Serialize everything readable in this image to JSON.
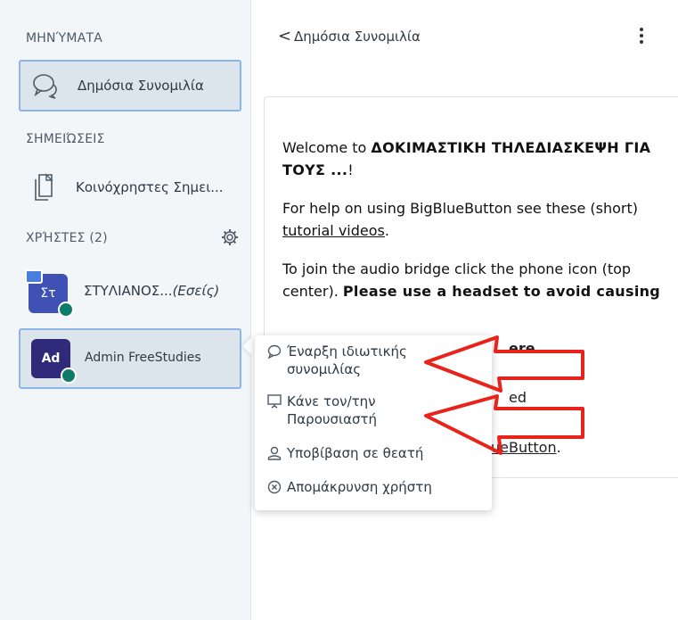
{
  "sidebar": {
    "messages_title": "ΜΗΝΎΜΑΤΑ",
    "public_chat_label": "Δημόσια Συνομιλία",
    "notes_title": "ΣΗΜΕΙΏΣΕΙΣ",
    "shared_notes_label": "Κοινόχρηστες Σημει...",
    "users_title": "ΧΡΉΣΤΕΣ (2)",
    "users": [
      {
        "initials": "Στ",
        "name": "ΣΤΥΛΙΑΝΟΣ...",
        "suffix": "(Εσείς)"
      },
      {
        "initials": "Ad",
        "name": "Admin FreeStudies"
      }
    ]
  },
  "chat": {
    "back_glyph": "<",
    "title": "Δημόσια Συνομιλία",
    "welcome": {
      "p1_prefix": "Welcome to ",
      "p1_bold": "ΔΟΚΙΜΑΣΤΙΚΗ ΤΗΛΕΔΙΑΣΚΕΨΗ ΓΙΑ ΤΟΥΣ ...",
      "p1_suffix": "!",
      "p2_prefix": "For help on using BigBlueButton see these (short) ",
      "p2_link": "tutorial videos",
      "p2_suffix": ".",
      "p3_prefix": "To join the audio bridge click the phone icon (top center). ",
      "p3_bold": "Please use a headset to avoid causing",
      "frag_1": "ere.",
      "frag_2": "ed",
      "frag_3": "ueButton",
      "frag_3_suffix": "."
    }
  },
  "context_menu": {
    "items": [
      {
        "icon": "chat-bubble-icon",
        "label_line1": "Έναρξη ιδιωτικής",
        "label_line2": "συνομιλίας"
      },
      {
        "icon": "presentation-icon",
        "label_line1": "Κάνε τον/την",
        "label_line2": "Παρουσιαστή"
      },
      {
        "icon": "user-icon",
        "label_line1": "Υποβίβαση σε θεατή"
      },
      {
        "icon": "remove-circle-icon",
        "label_line1": "Απομάκρυνση χρήστη"
      }
    ]
  },
  "colors": {
    "sidebar_bg": "#f3f6f9",
    "selected_bg": "#dce4ec",
    "selected_border": "#8cb6e8",
    "avatar_blue": "#3f51b5",
    "avatar_dark": "#2f2b7a",
    "mic_green": "#0d7a6a",
    "annotation_red": "#e8231c"
  }
}
